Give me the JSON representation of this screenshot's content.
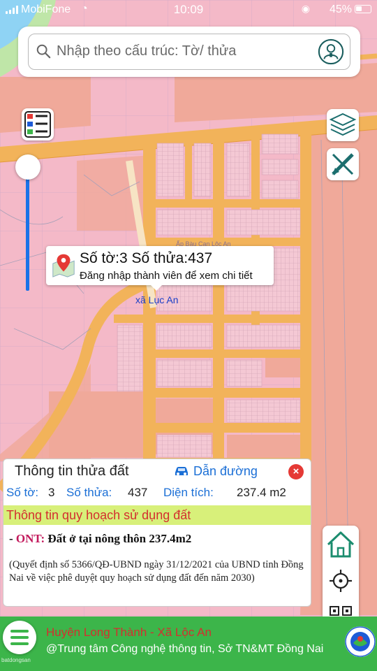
{
  "status_bar": {
    "carrier": "MobiFone",
    "time": "10:09",
    "battery": "45%"
  },
  "search": {
    "placeholder": "Nhập theo cấu trúc: Tờ/ thửa"
  },
  "map": {
    "popup_title": "Số tờ:3 Số thửa:437",
    "popup_subtitle": "Đăng nhập thành viên để xem chi tiết",
    "place_label": "xã Lục An",
    "watermark": "Ấp Bàu Cạn Lộc An"
  },
  "info_panel": {
    "title": "Thông tin thửa đất",
    "directions_label": "Dẫn đường",
    "sheet_label": "Số tờ:",
    "sheet_value": "3",
    "parcel_label": "Số thửa:",
    "parcel_value": "437",
    "area_label": "Diện tích:",
    "area_value": "237.4 m2",
    "section_title": "Thông tin quy hoạch sử dụng đất",
    "land_prefix": "- ",
    "land_code": "ONT:",
    "land_desc": " Đất ở tại nông thôn 237.4m2",
    "decision_text": "(Quyết định số 5366/QĐ-UBND ngày 31/12/2021 của UBND tỉnh Đồng Nai về việc phê duyệt quy hoạch sử dụng đất đến năm 2030)"
  },
  "bottom_bar": {
    "title": "Huyện Long Thành - Xã Lộc An",
    "subtitle": "@Trung tâm Công nghệ thông tin, Sở TN&MT Đồng Nai",
    "watermark": "batdongsan"
  },
  "colors": {
    "residential_pink": "#f4b9c8",
    "road_orange": "#f2b35a",
    "urban_salmon": "#f0a99a",
    "brand_green": "#3cb54a",
    "link_blue": "#1b6fd6",
    "alert_red": "#d32f2f",
    "highlight_lime": "#d8f07a"
  },
  "icons": [
    "search-icon",
    "user-icon",
    "legend-icon",
    "layers-icon",
    "measure-icon",
    "map-pin-icon",
    "car-icon",
    "close-icon",
    "home-icon",
    "locate-icon",
    "qr-code-icon",
    "menu-icon"
  ]
}
